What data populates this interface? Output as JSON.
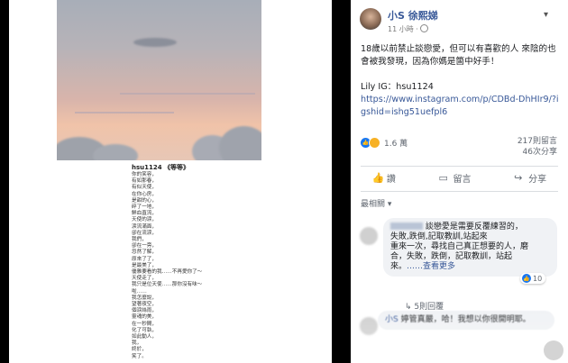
{
  "poem": {
    "title": "hsu1124 《等等》",
    "lines": [
      "你的笑容，",
      "有如那春，",
      "有似天使，",
      "在你心房，",
      "是甜的心，",
      "碎了一地，",
      "鮮血直流，",
      "天使的淚，",
      "淚流滿面，",
      "卻在流淚，",
      "我們，",
      "卻在一旁，",
      "忽然了解，",
      "原來了了，",
      "是最美了，",
      "優雅要看的我……不再愛你了～",
      "天使走了，",
      "我只是位天使……那你沒有味～",
      "啦……",
      "我怎麼說，",
      "望著夜空，",
      "個淚絲雨，",
      "靈魂的美，",
      "在一秒間，",
      "化了可執，",
      "如此動人，",
      "我，",
      "終於，",
      "笑了。"
    ]
  },
  "post": {
    "author": "小S 徐熙娣",
    "time": "11 小時",
    "line1": "18歲以前禁止談戀愛，但可以有喜歡的人 來陰的也會被我發現，因為你媽是箇中好手！",
    "line2": "Lily IG：hsu1124",
    "url": "https://www.instagram.com/p/CDBd-DhHIr9/?igshid=ishg51uefpl6"
  },
  "reactions": {
    "count": "1.6 萬",
    "comments": "217則留言",
    "shares": "46次分享"
  },
  "actions": {
    "like": "讚",
    "comment": "留言",
    "share": "分享"
  },
  "sort_label": "最相關",
  "comments": [
    {
      "text_lines": [
        "談戀愛是需要反覆練習的，",
        "失敗,跌倒,記取教訓,站起來",
        "重來一次，尋找自己真正想要的人，磨",
        "合，失敗，跌倒，記取教訓，站起",
        "來。"
      ],
      "more": "……查看更多",
      "likes": "10",
      "replies": "5則回覆"
    },
    {
      "author": "小S",
      "text_lines": [
        "婷管真嚴，哈！我想以你很",
        "開明耶。"
      ]
    }
  ]
}
